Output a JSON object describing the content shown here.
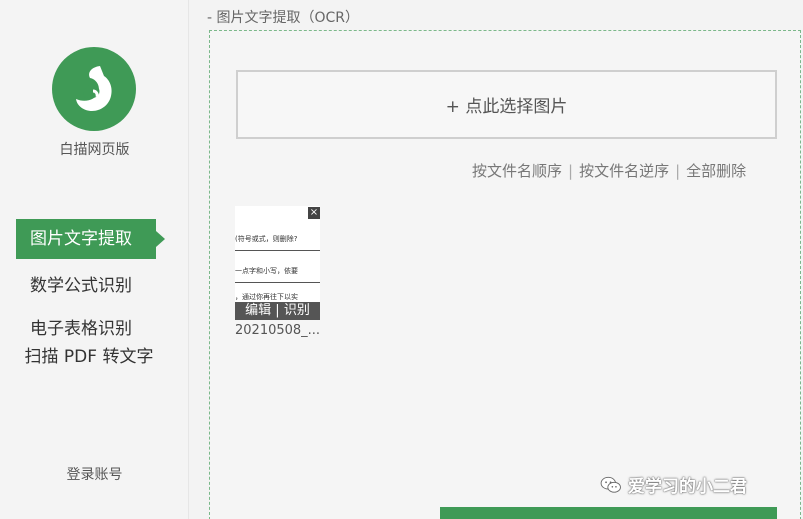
{
  "sidebar": {
    "app_name": "白描网页版",
    "nav": [
      {
        "label": "图片文字提取",
        "active": true
      },
      {
        "label": "数学公式识别"
      },
      {
        "label": "电子表格识别"
      },
      {
        "label": "扫描 PDF 转文字"
      }
    ],
    "login_label": "登录账号",
    "logo_icon": "squirrel-logo-icon"
  },
  "main": {
    "section_title": "- 图片文字提取（OCR）",
    "upload_label": "+ 点此选择图片",
    "sort": {
      "asc": "按文件名顺序",
      "desc": "按文件名逆序",
      "delete_all": "全部删除",
      "separator": "|"
    },
    "file": {
      "name": "20210508_...",
      "edit": "编辑",
      "recognize": "识别",
      "close": "×",
      "preview_lines": [
        "(符号或式，则删除?",
        "一点字和小写，依要",
        "，通过你再往下以实"
      ]
    }
  },
  "watermark": "爱学习的小二君",
  "colors": {
    "accent": "#3f9a56"
  }
}
